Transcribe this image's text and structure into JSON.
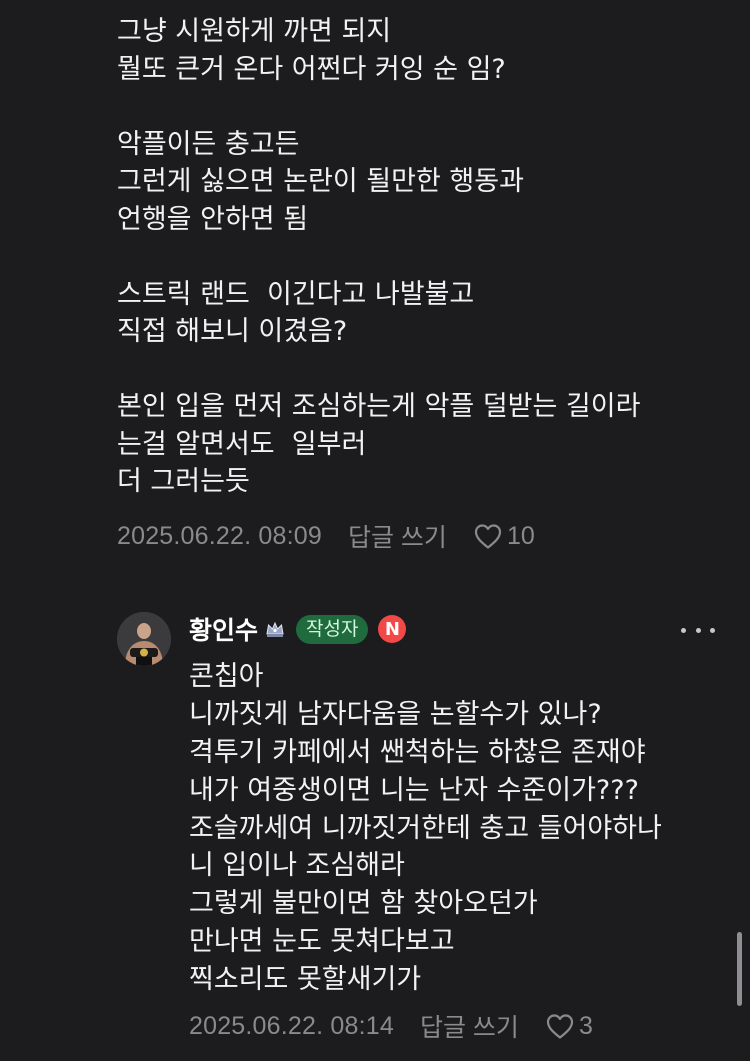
{
  "comment1": {
    "lines": [
      "그냥 시원하게 까면 되지",
      "뭘또 큰거 온다 어쩐다 커잉 순 임?",
      "",
      "악플이든 충고든",
      "그런게 싫으면 논란이 될만한 행동과",
      "언행을 안하면 됨",
      "",
      "스트릭 랜드  이긴다고 나발불고",
      "직접 해보니 이겼음?",
      "",
      "본인 입을 먼저 조심하는게 악플 덜받는 길이라",
      "는걸 알면서도  일부러",
      "더 그러는듯"
    ],
    "date": "2025.06.22. 08:09",
    "reply_label": "답글 쓰기",
    "like_count": "10"
  },
  "comment2": {
    "author": "황인수",
    "rank_icon": "crown-badge-icon",
    "writer_badge": "작성자",
    "n_badge": "N",
    "lines": [
      "콘칩아",
      "니까짓게 남자다움을 논할수가 있나?",
      "격투기 카페에서 쌘척하는 하찮은 존재야",
      "내가 여중생이면 니는 난자 수준이가???",
      "조슬까세여 니까짓거한테 충고 들어야하나",
      "니 입이나 조심해라",
      "그렇게 불만이면 함 찾아오던가",
      "만나면 눈도 못쳐다보고",
      "찍소리도 못할새기가"
    ],
    "date": "2025.06.22. 08:14",
    "reply_label": "답글 쓰기",
    "like_count": "3"
  },
  "colors": {
    "background": "#1c1c1e",
    "text": "#f2f2f2",
    "meta": "#8a8a8d",
    "writer_badge_bg": "#1f6b3d",
    "n_badge_bg": "#f24848"
  }
}
